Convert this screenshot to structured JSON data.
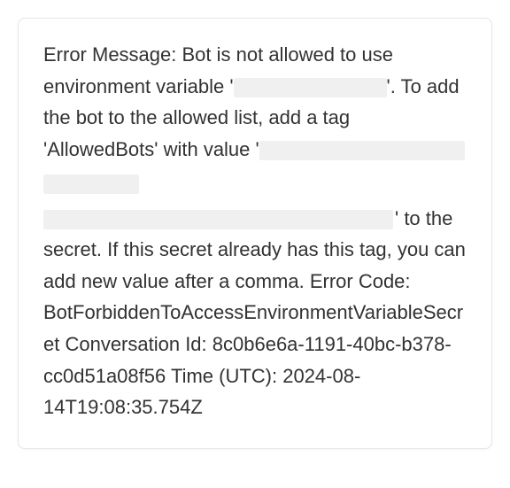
{
  "error": {
    "prefix": "Error Message: Bot is not allowed to use environment variable '",
    "mid1": "'. To add the bot to the allowed list, add a tag 'AllowedBots' with value '",
    "mid2": "' to the secret. If this secret already has this tag, you can add new value after a comma. Error Code: BotForbiddenToAccessEnvironmentVariableSecret Conversation Id: 8c0b6e6a-1191-40bc-b378-cc0d51a08f56 Time (UTC): 2024-08-14T19:08:35.754Z"
  }
}
